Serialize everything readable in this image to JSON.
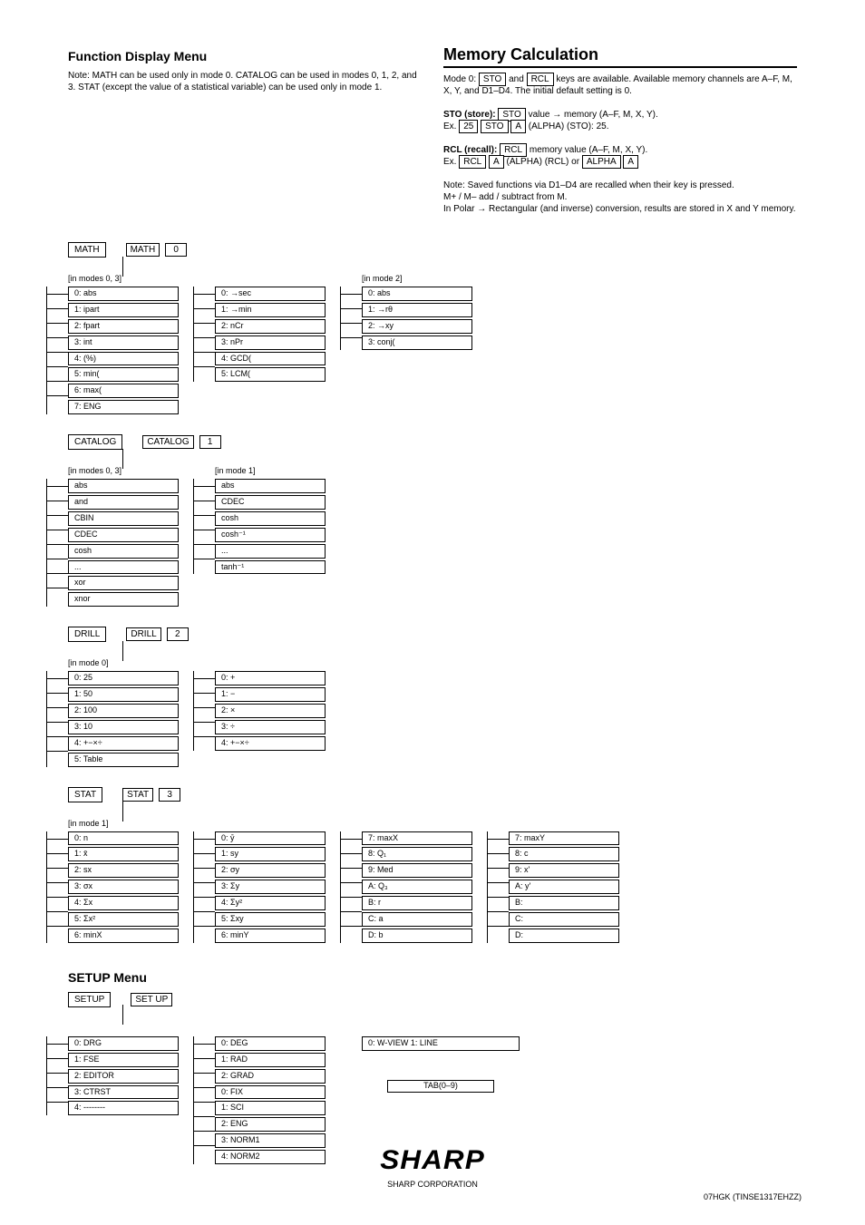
{
  "intro": {
    "title": "Function Display Menu",
    "note": "Note: MATH can be used only in mode 0. CATALOG can be used in modes 0, 1, 2, and 3. STAT (except the value of a statistical variable) can be used only in mode 1."
  },
  "memory": {
    "heading": "Memory Calculation",
    "para1": "Mode 0: ",
    "para1b": " and ",
    "para1c": " keys are available. Available memory channels are A–F, M, X, Y, and D1–D4. The initial default setting is 0.",
    "para2a": "STO (store): ",
    "para2b": " value → memory (A–F, M, X, Y).",
    "para2c": "Ex. ",
    "para2d": " (ALPHA) (STO): 25.",
    "rcl1": "RCL (recall): ",
    "rcl2": " memory value (A–F, M, X, Y).",
    "rcl3": "Ex. ",
    "rcl4": " (ALPHA) (RCL) or ",
    "note": "Note: Saved functions via D1–D4 are recalled when their key is pressed.",
    "m_note": "M+ / M– add / subtract from M.",
    "trig": "In Polar → Rectangular (and inverse) conversion, results are stored in X and Y memory."
  },
  "math": {
    "headBox": "MATH",
    "key2": "MATH",
    "keynum": "0",
    "group1Label": "[in modes 0, 3]",
    "group1": [
      "0: abs",
      "1: ipart",
      "2: fpart",
      "3: int",
      "4: (%)",
      "5: min(",
      "6: max(",
      "7: ENG"
    ],
    "group2Label": "",
    "group2": [
      "0: →sec",
      "1: →min",
      "2: nCr",
      "3: nPr",
      "4: GCD(",
      "5: LCM("
    ],
    "group3Label": "[in mode 2]",
    "group3": [
      "0: abs",
      "1: →rθ",
      "2: →xy",
      "3: conj("
    ]
  },
  "catalog": {
    "headBox": "CATALOG",
    "key2": "CATALOG",
    "keynum": "1",
    "group1Label": "[in modes 0, 3]",
    "group1": [
      "abs",
      "and",
      "CBIN",
      "CDEC",
      "cosh",
      "...",
      "xor",
      "xnor"
    ],
    "group2Label": "[in mode 1]",
    "group2": [
      "abs",
      "CDEC",
      "cosh",
      "cosh⁻¹",
      "...",
      "tanh⁻¹"
    ]
  },
  "drill": {
    "headBox": "DRILL",
    "key2": "DRILL",
    "keynum": "2",
    "group1Label": "[in mode 0]",
    "group1": [
      "0: 25",
      "1: 50",
      "2: 100",
      "3: 10",
      "4: +−×÷",
      "5: Table"
    ],
    "group2Label": "",
    "group2": [
      "0: +",
      "1: −",
      "2: ×",
      "3: ÷",
      "4: +−×÷"
    ]
  },
  "stat": {
    "headBox": "STAT",
    "key2": "STAT",
    "keynum": "3",
    "group1Label": "[in mode 1]",
    "group1": [
      "0: n",
      "1: x̄",
      "2: sx",
      "3: σx",
      "4: Σx",
      "5: Σx²",
      "6: minX"
    ],
    "group2": [
      "0: ȳ",
      "1: sy",
      "2: σy",
      "3: Σy",
      "4: Σy²",
      "5: Σxy",
      "6: minY"
    ],
    "group3Label": "",
    "group3": [
      "7: maxX",
      "8: Q₁",
      "9: Med",
      "A: Q₃",
      "B: r",
      "C: a",
      "D: b"
    ],
    "group4": [
      "7: maxY",
      "8: c",
      "9: x'",
      "A: y'",
      "B: ",
      "C: ",
      "D: "
    ]
  },
  "setup": {
    "title": "SETUP Menu",
    "headBox": "SETUP",
    "keynum": "",
    "col1": [
      "0: DRG",
      "1: FSE",
      "2: EDITOR",
      "3: CTRST",
      "4: --------"
    ],
    "col2": [
      "0: DEG",
      "1: RAD",
      "2: GRAD",
      "0: FIX",
      "1: SCI",
      "2: ENG",
      "3: NORM1",
      "4: NORM2"
    ],
    "col3Label": "0: W-VIEW   1: LINE",
    "tab": "TAB(0–9)"
  },
  "footer": {
    "corp": "SHARP CORPORATION",
    "code": "07HGK (TINSE1317EHZZ)"
  }
}
